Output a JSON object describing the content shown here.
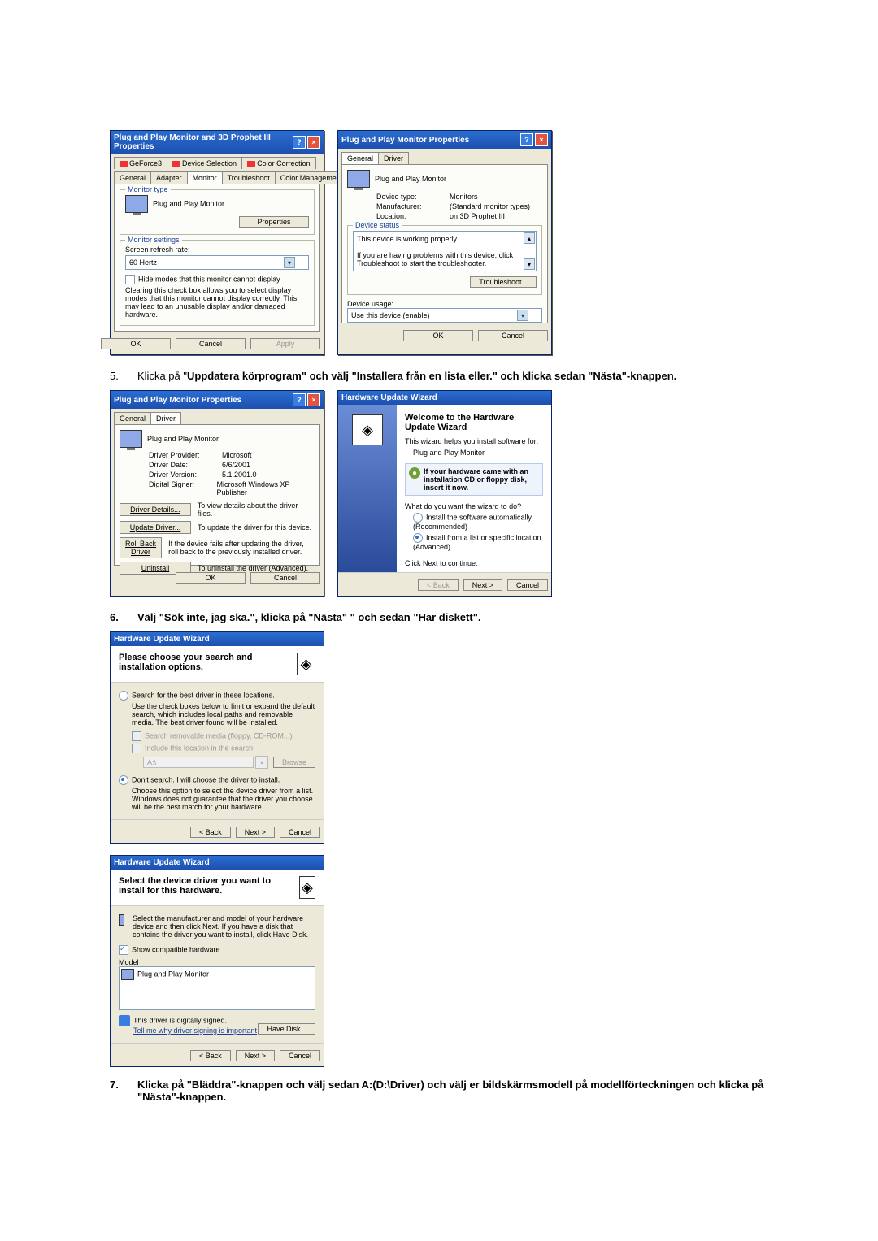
{
  "dlg1": {
    "title": "Plug and Play Monitor and 3D Prophet III Properties",
    "tabs_top": [
      "GeForce3",
      "Device Selection",
      "Color Correction"
    ],
    "tabs_bot": [
      "General",
      "Adapter",
      "Monitor",
      "Troubleshoot",
      "Color Management"
    ],
    "group_monitor_type": "Monitor type",
    "monitor_name": "Plug and Play Monitor",
    "properties_btn": "Properties",
    "group_monitor_settings": "Monitor settings",
    "refresh_label": "Screen refresh rate:",
    "refresh_value": "60 Hertz",
    "hide_modes": "Hide modes that this monitor cannot display",
    "hide_desc": "Clearing this check box allows you to select display modes that this monitor cannot display correctly. This may lead to an unusable display and/or damaged hardware.",
    "ok": "OK",
    "cancel": "Cancel",
    "apply": "Apply"
  },
  "dlg2": {
    "title": "Plug and Play Monitor Properties",
    "tab_general": "General",
    "tab_driver": "Driver",
    "name": "Plug and Play Monitor",
    "device_type_l": "Device type:",
    "device_type_v": "Monitors",
    "manufacturer_l": "Manufacturer:",
    "manufacturer_v": "(Standard monitor types)",
    "location_l": "Location:",
    "location_v": "on 3D Prophet III",
    "group_status": "Device status",
    "status_text": "This device is working properly.",
    "status_help": "If you are having problems with this device, click Troubleshoot to start the troubleshooter.",
    "troubleshoot_btn": "Troubleshoot...",
    "usage_l": "Device usage:",
    "usage_v": "Use this device (enable)",
    "ok": "OK",
    "cancel": "Cancel"
  },
  "step5": {
    "num": "5.",
    "text_pre": "Klicka på \"",
    "text_bold": "Uppdatera körprogram\" och välj \"Installera från en lista eller.\" och klicka sedan \"Nästa\"-knappen."
  },
  "dlg3": {
    "title": "Plug and Play Monitor Properties",
    "tab_general": "General",
    "tab_driver": "Driver",
    "name": "Plug and Play Monitor",
    "provider_l": "Driver Provider:",
    "provider_v": "Microsoft",
    "date_l": "Driver Date:",
    "date_v": "6/6/2001",
    "version_l": "Driver Version:",
    "version_v": "5.1.2001.0",
    "signer_l": "Digital Signer:",
    "signer_v": "Microsoft Windows XP Publisher",
    "details_btn": "Driver Details...",
    "details_desc": "To view details about the driver files.",
    "update_btn": "Update Driver...",
    "update_desc": "To update the driver for this device.",
    "rollback_btn": "Roll Back Driver",
    "rollback_desc": "If the device fails after updating the driver, roll back to the previously installed driver.",
    "uninstall_btn": "Uninstall",
    "uninstall_desc": "To uninstall the driver (Advanced).",
    "ok": "OK",
    "cancel": "Cancel"
  },
  "dlg4": {
    "title": "Hardware Update Wizard",
    "welcome": "Welcome to the Hardware Update Wizard",
    "helps": "This wizard helps you install software for:",
    "device": "Plug and Play Monitor",
    "cd_note": "If your hardware came with an installation CD or floppy disk, insert it now.",
    "question": "What do you want the wizard to do?",
    "opt1": "Install the software automatically (Recommended)",
    "opt2": "Install from a list or specific location (Advanced)",
    "cont": "Click Next to continue.",
    "back": "< Back",
    "next": "Next >",
    "cancel": "Cancel"
  },
  "step6": {
    "num": "6.",
    "text": "Välj \"Sök inte, jag ska.\", klicka på \"Nästa\" \" och sedan \"Har diskett\"."
  },
  "dlg5": {
    "title": "Hardware Update Wizard",
    "header": "Please choose your search and installation options.",
    "opt1": "Search for the best driver in these locations.",
    "opt1_desc": "Use the check boxes below to limit or expand the default search, which includes local paths and removable media. The best driver found will be installed.",
    "chk1": "Search removable media (floppy, CD-ROM...)",
    "chk2": "Include this location in the search:",
    "path": "A:\\",
    "browse": "Browse",
    "opt2": "Don't search. I will choose the driver to install.",
    "opt2_desc": "Choose this option to select the device driver from a list. Windows does not guarantee that the driver you choose will be the best match for your hardware.",
    "back": "< Back",
    "next": "Next >",
    "cancel": "Cancel"
  },
  "dlg6": {
    "title": "Hardware Update Wizard",
    "header": "Select the device driver you want to install for this hardware.",
    "instr": "Select the manufacturer and model of your hardware device and then click Next. If you have a disk that contains the driver you want to install, click Have Disk.",
    "show_compat": "Show compatible hardware",
    "model_l": "Model",
    "model_item": "Plug and Play Monitor",
    "signed": "This driver is digitally signed.",
    "tell_me": "Tell me why driver signing is important",
    "have_disk": "Have Disk...",
    "back": "< Back",
    "next": "Next >",
    "cancel": "Cancel"
  },
  "step7": {
    "num": "7.",
    "text": "Klicka på \"Bläddra\"-knappen och välj sedan A:(D:\\Driver) och välj er bildskärmsmodell på modellförteckningen och klicka på \"Nästa\"-knappen."
  }
}
